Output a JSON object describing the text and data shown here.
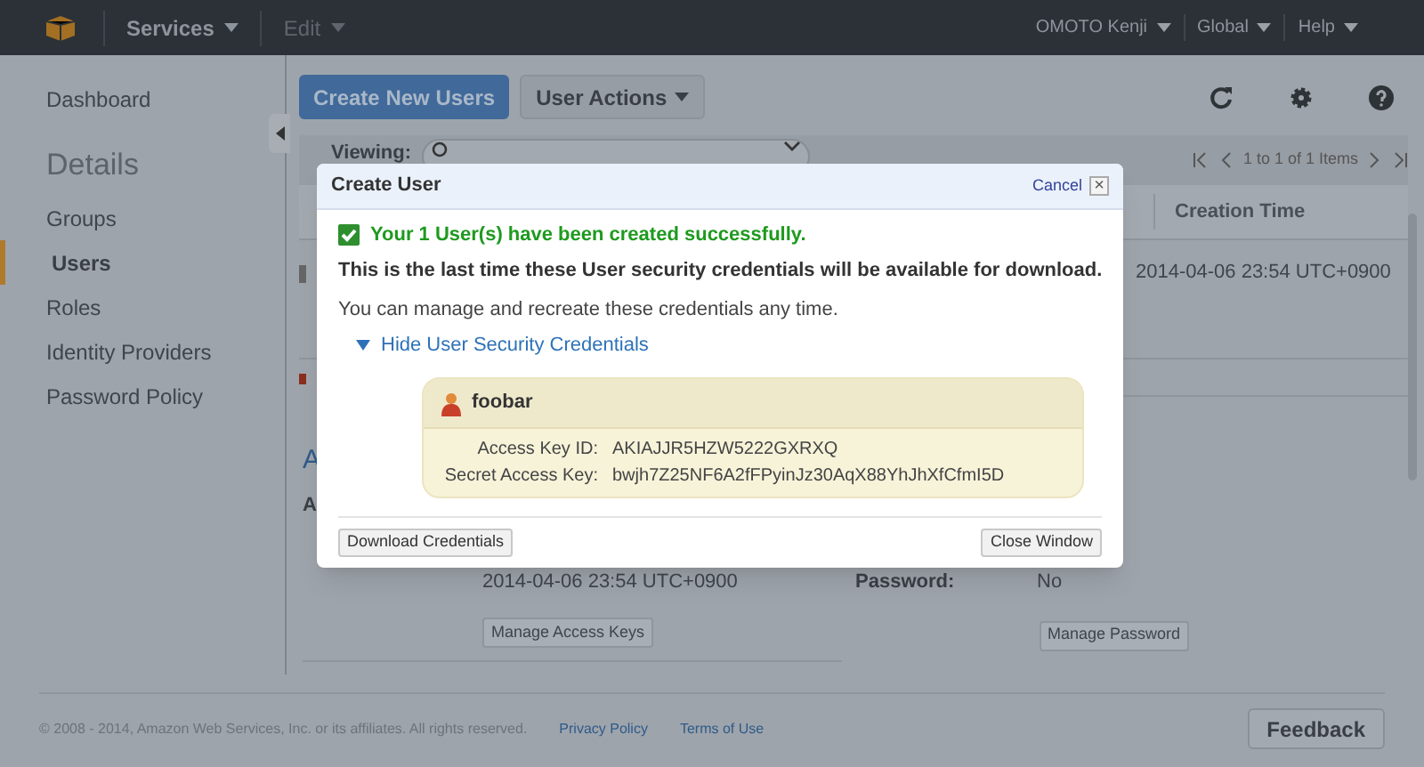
{
  "top_bar": {
    "menus": [
      {
        "label": "Services",
        "disabled": false
      },
      {
        "label": "Edit",
        "disabled": true
      }
    ],
    "right_menus": [
      "OMOTO Kenji",
      "Global",
      "Help"
    ]
  },
  "sidebar": {
    "items": [
      {
        "label": "Dashboard",
        "kind": "item",
        "selected": false
      },
      {
        "label": "Details",
        "kind": "heading"
      },
      {
        "label": "Groups",
        "kind": "item",
        "selected": false
      },
      {
        "label": "Users",
        "kind": "item",
        "selected": true
      },
      {
        "label": "Roles",
        "kind": "item",
        "selected": false
      },
      {
        "label": "Identity Providers",
        "kind": "item",
        "selected": false
      },
      {
        "label": "Password Policy",
        "kind": "item",
        "selected": false
      }
    ]
  },
  "toolbar": {
    "primary_button": "Create New Users",
    "actions_button": "User Actions"
  },
  "filter": {
    "label": "Viewing:",
    "pagination": "1 to 1 of 1 Items"
  },
  "table": {
    "columns": [
      "Creation Time"
    ],
    "rows": [
      {
        "creation_time": "2014-04-06 23:54 UTC+0900"
      }
    ]
  },
  "details": {
    "heading": "A",
    "label": "A",
    "access_key_date": "2014-04-06 23:54 UTC+0900",
    "manage_keys_button": "Manage Access Keys",
    "password_label": "Password:",
    "password_value": "No",
    "manage_password_button": "Manage Password"
  },
  "footer": {
    "copyright": "© 2008 - 2014, Amazon Web Services, Inc. or its affiliates. All rights reserved.",
    "links": [
      "Privacy Policy",
      "Terms of Use"
    ],
    "feedback_button": "Feedback"
  },
  "dialog": {
    "title": "Create User",
    "cancel": "Cancel",
    "close_icon": "×",
    "success": "Your 1 User(s) have been created successfully.",
    "warning": "This is the last time these User security credentials will be available for download.",
    "info": "You can manage and recreate these credentials any time.",
    "toggle": {
      "label": "Hide User Security Credentials",
      "expanded": true
    },
    "user": {
      "name": "foobar",
      "fields": [
        {
          "label": "Access Key ID:",
          "value": "AKIAJJR5HZW5222GXRXQ"
        },
        {
          "label": "Secret Access Key:",
          "value": "bwjh7Z25NF6A2fFPyinJz30AqX88YhJhXfCfmI5D"
        }
      ]
    },
    "buttons": [
      "Download Credentials",
      "Close Window"
    ]
  }
}
